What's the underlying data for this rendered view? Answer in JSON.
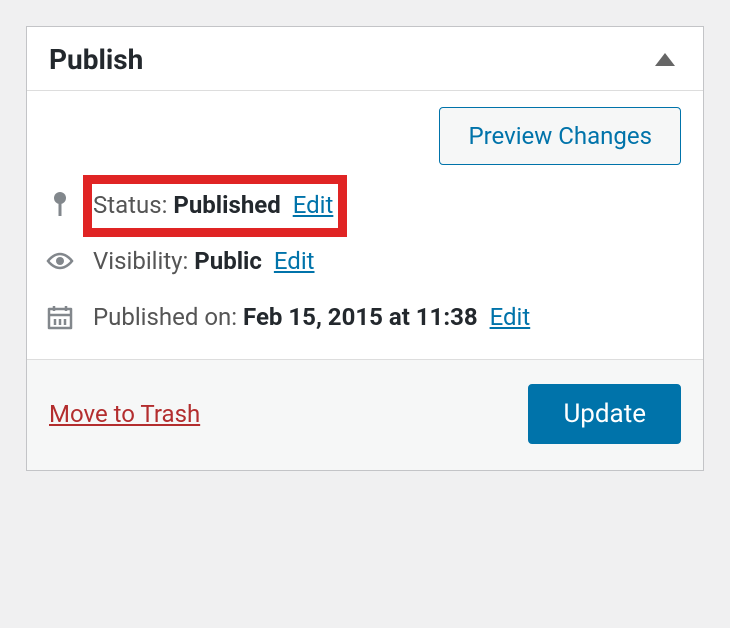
{
  "panel": {
    "title": "Publish"
  },
  "preview": {
    "label": "Preview Changes"
  },
  "status": {
    "label": "Status:",
    "value": "Published",
    "edit": "Edit"
  },
  "visibility": {
    "label": "Visibility:",
    "value": "Public",
    "edit": "Edit"
  },
  "published": {
    "label": "Published on:",
    "value": "Feb 15, 2015 at 11:38",
    "edit": "Edit"
  },
  "footer": {
    "trash": "Move to Trash",
    "update": "Update"
  }
}
